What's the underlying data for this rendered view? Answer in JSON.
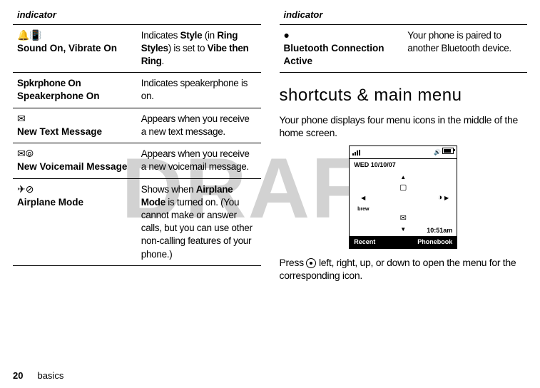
{
  "watermark": "DRAFT",
  "left_table": {
    "header": "indicator",
    "rows": [
      {
        "icon": "🔔📳",
        "icon_name": "sound-on-vibrate-on-icon",
        "title": "Sound On, Vibrate On",
        "desc_pre": "Indicates ",
        "desc_b1": "Style",
        "desc_mid1": " (in ",
        "desc_b2": "Ring Styles",
        "desc_mid2": ") is set to ",
        "desc_b3": "Vibe then Ring",
        "desc_post": "."
      },
      {
        "icon": "",
        "icon_name": "speakerphone-on-icon",
        "pretitle": "Spkrphone On",
        "title": "Speakerphone On",
        "desc": "Indicates speakerphone is on."
      },
      {
        "icon": "✉",
        "icon_name": "new-text-message-icon",
        "title": "New Text Message",
        "desc": "Appears when you receive a new text message."
      },
      {
        "icon": "✉⦾",
        "icon_name": "new-voicemail-message-icon",
        "title": "New Voicemail Message",
        "desc": "Appears when you receive a new voicemail message."
      },
      {
        "icon": "✈⊘",
        "icon_name": "airplane-mode-icon",
        "title": "Airplane Mode",
        "desc_pre": "Shows when ",
        "desc_b1": "Airplane Mode",
        "desc_post": " is turned on. (You cannot make or answer calls, but you can use other non-calling features of your phone.)"
      }
    ]
  },
  "right_table": {
    "header": "indicator",
    "rows": [
      {
        "icon": "●",
        "icon_name": "bluetooth-connection-active-icon",
        "title": "Bluetooth Connection Active",
        "desc": "Your phone is paired to another Bluetooth device."
      }
    ]
  },
  "section_heading": "shortcuts & main menu",
  "section_intro": "Your phone displays four menu icons in the middle of the home screen.",
  "phone": {
    "date": "WED 10/10/07",
    "time": "10:51am",
    "softkey_left": "Recent",
    "softkey_right": "Phonebook",
    "nav_up_icon": "▢",
    "nav_down_icon": "✉",
    "nav_left_label": "brew",
    "nav_right_icon": "◑"
  },
  "section_outro_pre": "Press ",
  "section_outro_post": " left, right, up, or down to open the menu for the corresponding icon.",
  "footer": {
    "page_number": "20",
    "section_name": "basics"
  }
}
